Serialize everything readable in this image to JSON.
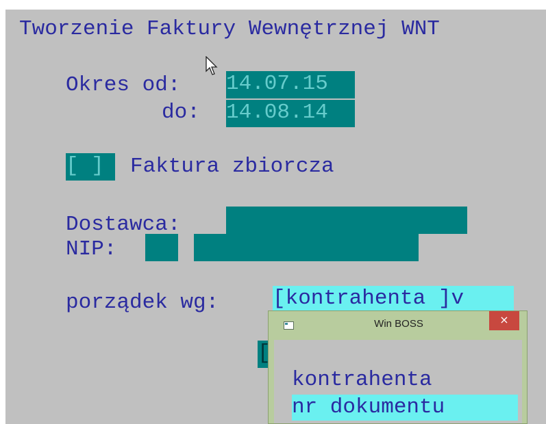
{
  "screen": {
    "title": "Tworzenie Faktury Wewnętrznej WNT",
    "period": {
      "from_label": "Okres od:",
      "from_value": "14.07.15",
      "to_label": "do:",
      "to_value": "14.08.14"
    },
    "collective_invoice": {
      "checkbox": "[ ]",
      "label": "Faktura zbiorcza"
    },
    "supplier": {
      "label": "Dostawca:",
      "nip_label": "NIP:"
    },
    "order": {
      "label": "porządek wg:",
      "value": "[kontrahenta ]v"
    },
    "partial_button": "["
  },
  "popup": {
    "title": "Win BOSS",
    "close_glyph": "×",
    "items": [
      {
        "label": "kontrahenta",
        "selected": false
      },
      {
        "label": "nr dokumentu",
        "selected": true
      }
    ]
  },
  "colors": {
    "background": "#c0c0c0",
    "text": "#2a2aa0",
    "field": "#008080",
    "highlight": "#6af0f0",
    "popup_frame": "#b8cc9e",
    "close_button": "#c8483f"
  },
  "icons": {
    "cursor": "mouse-pointer-icon",
    "app": "window-app-icon",
    "close": "close-icon"
  }
}
